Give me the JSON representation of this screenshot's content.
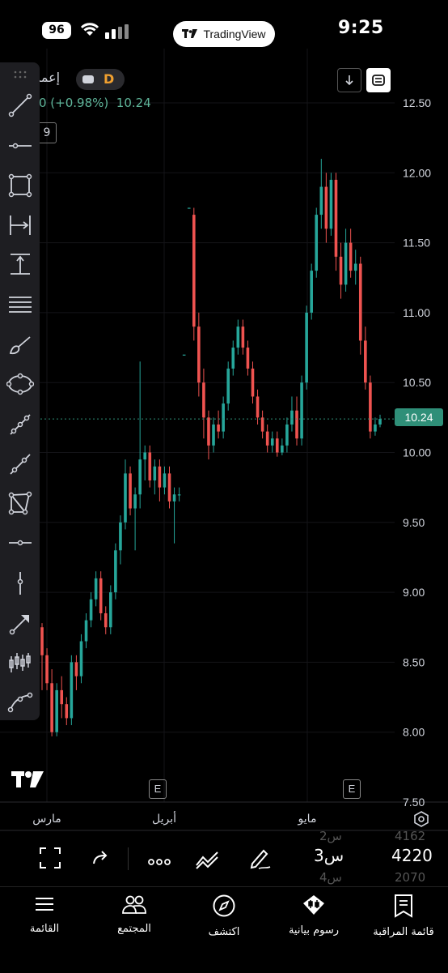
{
  "status_bar": {
    "time": "9:25",
    "battery": "96"
  },
  "app_pill": {
    "label": "TradingView"
  },
  "symbol": {
    "name": "إعما",
    "badge": "D",
    "change": "0 (+0.98%)",
    "price": "10.24",
    "box_label": "9"
  },
  "chart_data": {
    "type": "candlestick",
    "y_axis": {
      "ticks": [
        "12.50",
        "12.00",
        "11.50",
        "11.00",
        "10.50",
        "10.00",
        "9.50",
        "9.00",
        "8.50",
        "8.00",
        "7.50"
      ],
      "ylim": [
        7.5,
        12.7
      ]
    },
    "x_axis": {
      "ticks": [
        "مارس",
        "أبريل",
        "مايو"
      ]
    },
    "last_price_label": "10.24",
    "earnings_markers": [
      "E",
      "E"
    ],
    "colors": {
      "up": "#26a69a",
      "down": "#ef5350"
    },
    "candles": [
      [
        8.75,
        8.55,
        8.78,
        8.3
      ],
      [
        8.55,
        8.35,
        8.6,
        8.3
      ],
      [
        8.35,
        8.0,
        8.45,
        7.97
      ],
      [
        8.0,
        8.3,
        8.35,
        7.97
      ],
      [
        8.3,
        8.2,
        8.4,
        8.1
      ],
      [
        8.2,
        8.1,
        8.25,
        8.05
      ],
      [
        8.1,
        8.5,
        8.55,
        8.05
      ],
      [
        8.5,
        8.4,
        8.55,
        8.3
      ],
      [
        8.4,
        8.65,
        8.7,
        8.35
      ],
      [
        8.65,
        8.8,
        8.85,
        8.6
      ],
      [
        8.8,
        8.95,
        9.0,
        8.75
      ],
      [
        8.95,
        9.1,
        9.15,
        8.9
      ],
      [
        9.1,
        8.85,
        9.15,
        8.8
      ],
      [
        8.85,
        8.75,
        8.9,
        8.7
      ],
      [
        8.75,
        9.0,
        9.05,
        8.7
      ],
      [
        9.0,
        9.3,
        9.35,
        8.95
      ],
      [
        9.3,
        9.5,
        9.55,
        9.2
      ],
      [
        9.5,
        9.85,
        9.95,
        9.45
      ],
      [
        9.85,
        9.6,
        9.9,
        9.55
      ],
      [
        9.6,
        9.7,
        9.75,
        9.3
      ],
      [
        9.7,
        9.95,
        10.65,
        9.6
      ],
      [
        9.95,
        10.0,
        10.05,
        9.8
      ],
      [
        10.0,
        9.8,
        10.05,
        9.75
      ],
      [
        9.8,
        9.9,
        9.95,
        9.7
      ],
      [
        9.9,
        9.75,
        9.95,
        9.65
      ],
      [
        9.75,
        9.85,
        9.9,
        9.7
      ],
      [
        9.85,
        9.65,
        9.9,
        9.6
      ],
      [
        9.65,
        9.7,
        9.75,
        9.35
      ],
      [
        9.7,
        9.7,
        9.75,
        9.65
      ],
      [
        10.7,
        10.7,
        10.7,
        10.7
      ],
      [
        11.75,
        11.75,
        11.75,
        11.75
      ],
      [
        11.7,
        10.9,
        11.75,
        10.8
      ],
      [
        10.9,
        10.5,
        11.0,
        10.4
      ],
      [
        10.5,
        10.25,
        10.6,
        10.1
      ],
      [
        10.25,
        10.05,
        10.3,
        9.95
      ],
      [
        10.05,
        10.2,
        10.25,
        10.0
      ],
      [
        10.2,
        10.15,
        10.3,
        10.1
      ],
      [
        10.15,
        10.35,
        10.4,
        10.1
      ],
      [
        10.35,
        10.6,
        10.65,
        10.3
      ],
      [
        10.6,
        10.75,
        10.8,
        10.55
      ],
      [
        10.75,
        10.9,
        10.95,
        10.7
      ],
      [
        10.9,
        10.75,
        10.95,
        10.7
      ],
      [
        10.75,
        10.6,
        10.8,
        10.55
      ],
      [
        10.6,
        10.4,
        10.65,
        10.35
      ],
      [
        10.4,
        10.25,
        10.45,
        10.2
      ],
      [
        10.25,
        10.15,
        10.3,
        10.1
      ],
      [
        10.15,
        10.05,
        10.2,
        10.0
      ],
      [
        10.05,
        10.1,
        10.15,
        10.0
      ],
      [
        10.1,
        10.0,
        10.15,
        9.97
      ],
      [
        10.0,
        10.05,
        10.1,
        9.98
      ],
      [
        10.05,
        10.2,
        10.25,
        10.0
      ],
      [
        10.2,
        10.3,
        10.4,
        10.15
      ],
      [
        10.3,
        10.1,
        10.4,
        10.05
      ],
      [
        10.1,
        10.5,
        10.55,
        10.05
      ],
      [
        10.5,
        11.0,
        11.05,
        10.45
      ],
      [
        11.0,
        11.3,
        11.35,
        10.95
      ],
      [
        11.3,
        11.7,
        11.75,
        11.25
      ],
      [
        11.7,
        11.9,
        12.1,
        11.6
      ],
      [
        11.9,
        11.6,
        12.0,
        11.5
      ],
      [
        11.6,
        11.95,
        12.0,
        11.55
      ],
      [
        11.95,
        11.4,
        12.0,
        11.3
      ],
      [
        11.4,
        11.2,
        11.5,
        11.1
      ],
      [
        11.2,
        11.5,
        11.6,
        11.15
      ],
      [
        11.5,
        11.3,
        11.6,
        11.25
      ],
      [
        11.3,
        11.35,
        11.45,
        11.2
      ],
      [
        11.35,
        10.8,
        11.4,
        10.7
      ],
      [
        10.8,
        10.5,
        10.9,
        10.45
      ],
      [
        10.5,
        10.15,
        10.55,
        10.1
      ],
      [
        10.15,
        10.2,
        10.25,
        10.12
      ],
      [
        10.2,
        10.24,
        10.27,
        10.18
      ]
    ]
  },
  "toolbar": {
    "tools": [
      "trend-line-icon",
      "horizontal-line-icon",
      "rectangle-icon",
      "date-range-icon",
      "price-range-icon",
      "parallel-lines-icon",
      "brush-icon",
      "ellipse-icon",
      "path-icon",
      "ray-icon",
      "polygon-icon",
      "horizontal-ray-icon",
      "vertical-line-icon",
      "arrow-icon",
      "bars-pattern-icon",
      "curve-icon"
    ]
  },
  "action_bar": {
    "interval": "3س",
    "interval_count": "4220",
    "faded_top_interval": "2س",
    "faded_top_count": "4162",
    "faded_bottom_interval": "4س",
    "faded_bottom_count": "2070"
  },
  "bottom_nav": {
    "items": [
      {
        "label": "القائمة",
        "icon": "menu-icon"
      },
      {
        "label": "المجتمع",
        "icon": "community-icon"
      },
      {
        "label": "اكتشف",
        "icon": "compass-icon"
      },
      {
        "label": "رسوم بيانية",
        "icon": "charts-icon"
      },
      {
        "label": "قائمة المراقبة",
        "icon": "watchlist-icon"
      }
    ]
  }
}
